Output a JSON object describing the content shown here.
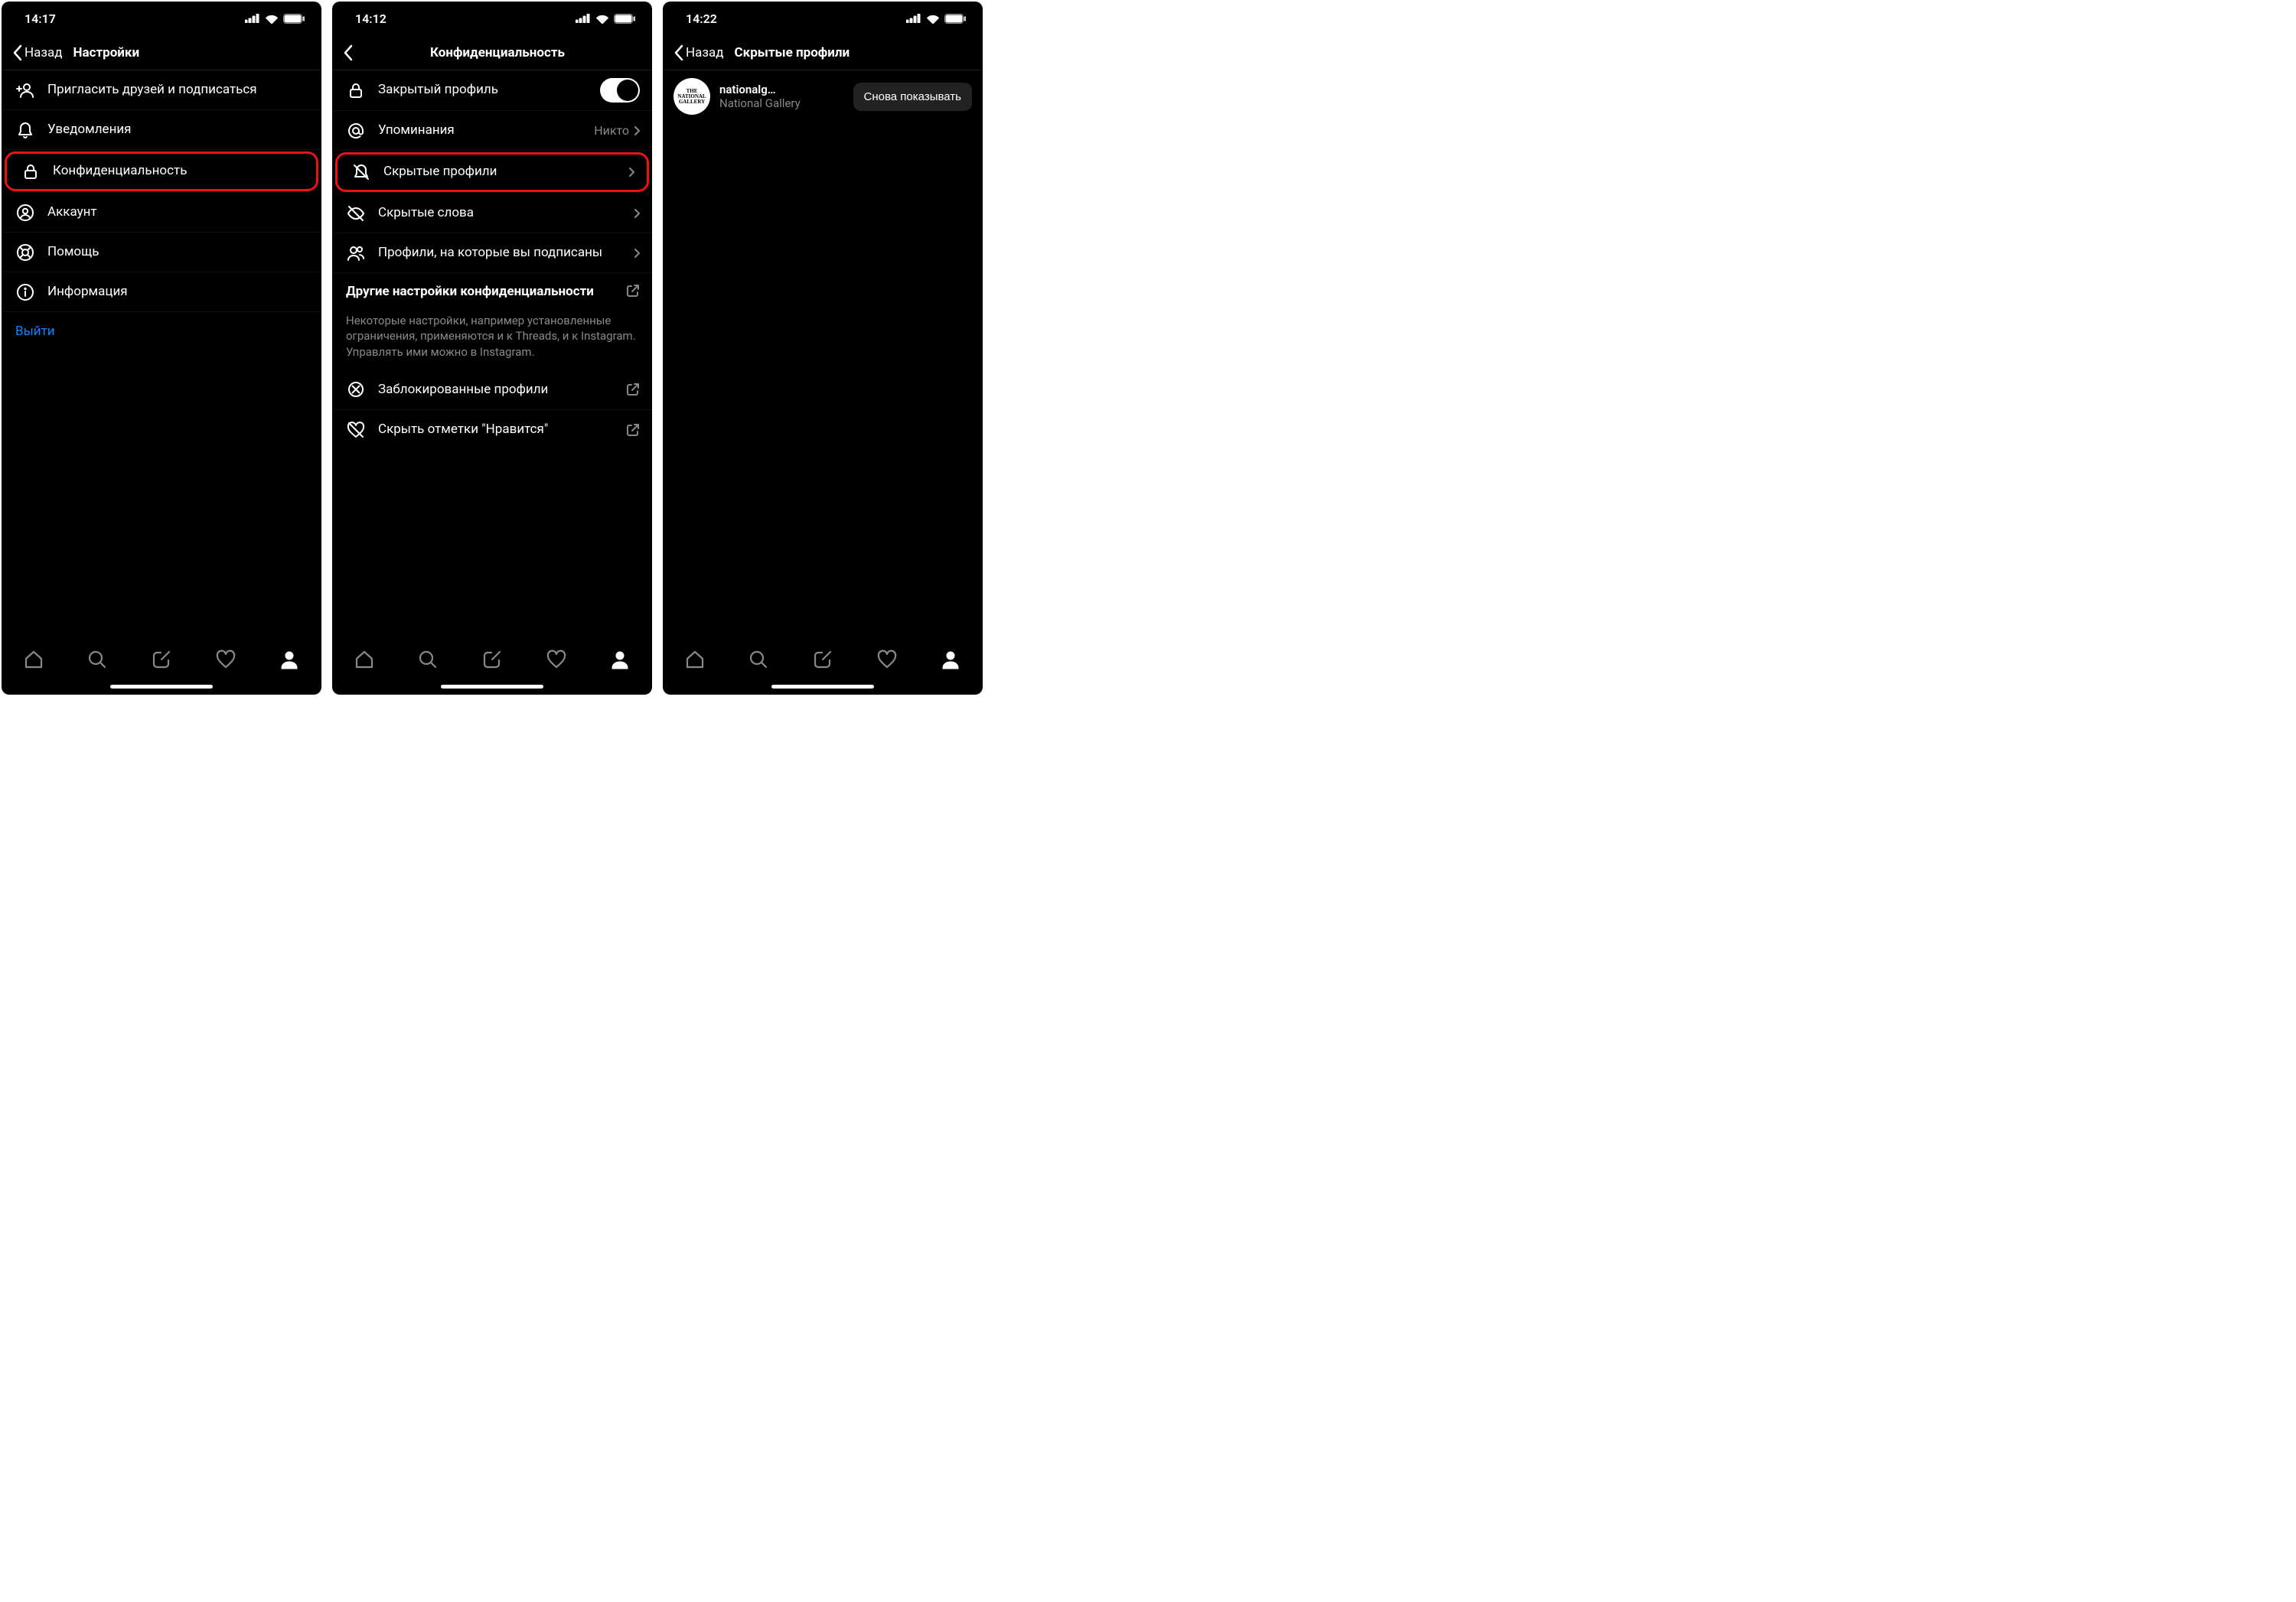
{
  "screen1": {
    "time": "14:17",
    "back": "Назад",
    "title": "Настройки",
    "items": {
      "invite": "Пригласить друзей и подписаться",
      "notifications": "Уведомления",
      "privacy": "Конфиденциальность",
      "account": "Аккаунт",
      "help": "Помощь",
      "info": "Информация",
      "logout": "Выйти"
    }
  },
  "screen2": {
    "time": "14:12",
    "title": "Конфиденциальность",
    "items": {
      "private_profile": "Закрытый профиль",
      "mentions": "Упоминания",
      "mentions_value": "Никто",
      "muted": "Скрытые профили",
      "hidden_words": "Скрытые слова",
      "following": "Профили, на которые вы подписаны",
      "other_title": "Другие настройки конфиденциальности",
      "other_desc": "Некоторые настройки, например установленные ограничения, применяются и к Threads, и к Instagram. Управлять ими можно в Instagram.",
      "blocked": "Заблокированные профили",
      "hide_likes": "Скрыть отметки \"Нравится\""
    }
  },
  "screen3": {
    "time": "14:22",
    "back": "Назад",
    "title": "Скрытые профили",
    "user": {
      "username": "nationalg…",
      "display": "National Gallery",
      "avatar_top": "THE",
      "avatar_mid": "NATIONAL",
      "avatar_bot": "GALLERY",
      "button": "Снова показывать"
    }
  }
}
